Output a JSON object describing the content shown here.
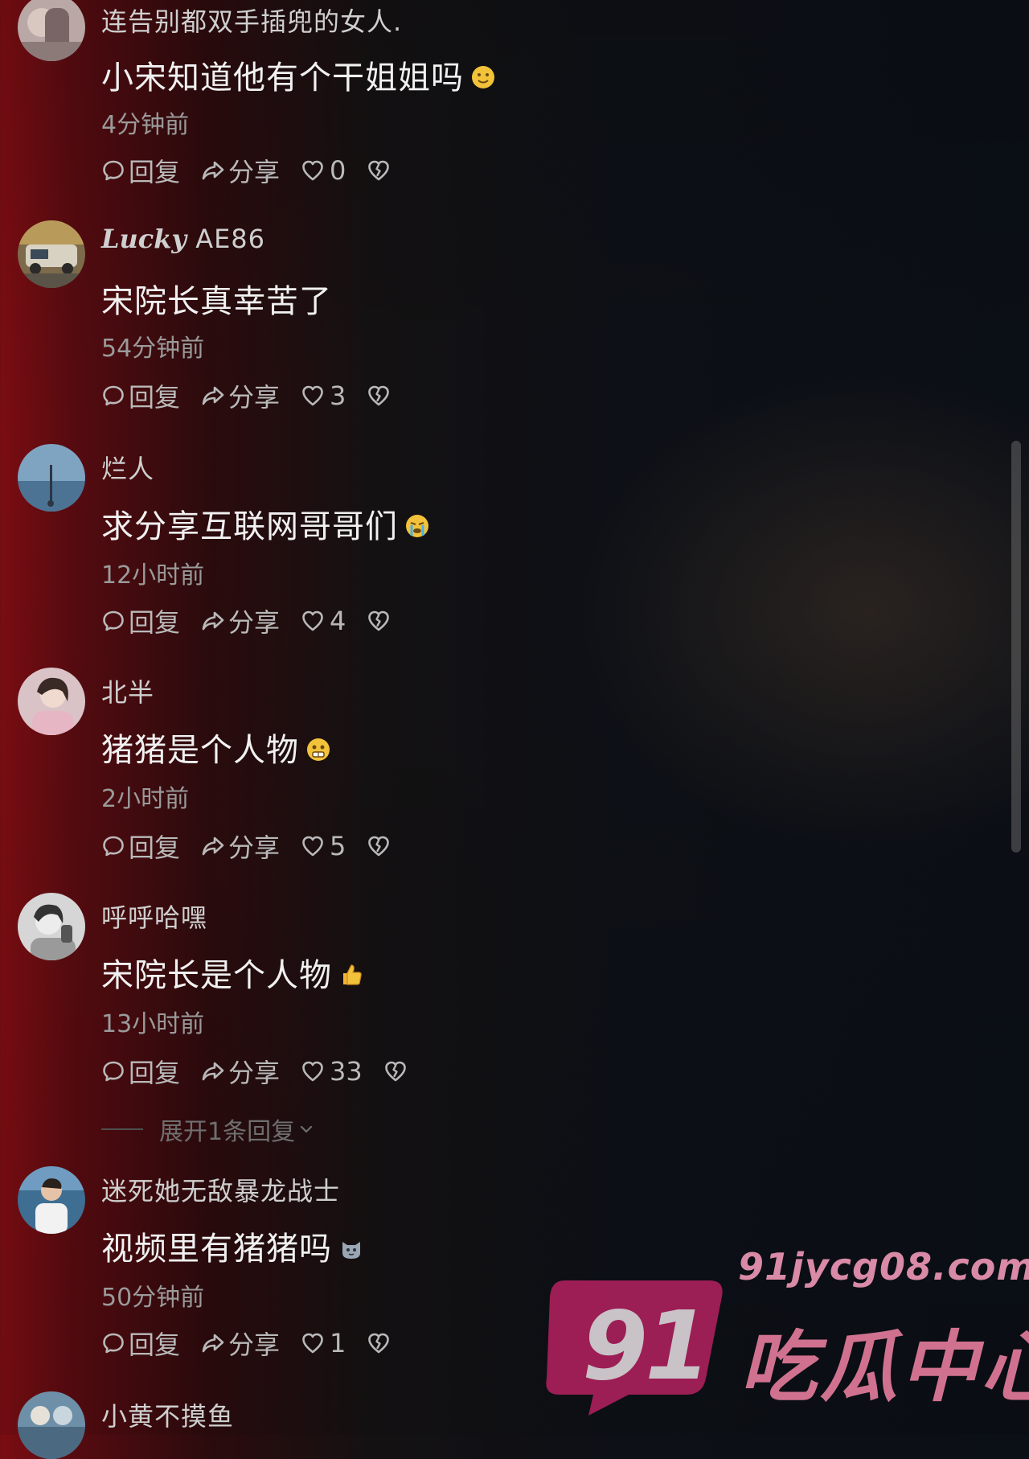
{
  "comments": [
    {
      "username": "连告别都双手插兜的女人.",
      "text": "小宋知道他有个干姐姐吗",
      "emoji": "smile-emoji",
      "time": "4分钟前",
      "reply_label": "回复",
      "share_label": "分享",
      "likes": "0"
    },
    {
      "username_script": "Lucky",
      "username": "AE86",
      "text": "宋院长真幸苦了",
      "time": "54分钟前",
      "reply_label": "回复",
      "share_label": "分享",
      "likes": "3"
    },
    {
      "username": "烂人",
      "text": "求分享互联网哥哥们",
      "emoji": "crying-emoji",
      "time": "12小时前",
      "reply_label": "回复",
      "share_label": "分享",
      "likes": "4"
    },
    {
      "username": "北半",
      "text": "猪猪是个人物",
      "emoji": "grimace-emoji",
      "time": "2小时前",
      "reply_label": "回复",
      "share_label": "分享",
      "likes": "5"
    },
    {
      "username": "呼呼哈嘿",
      "text": "宋院长是个人物",
      "emoji": "thumbs-up-emoji",
      "time": "13小时前",
      "reply_label": "回复",
      "share_label": "分享",
      "likes": "33",
      "expand_label": "展开1条回复"
    },
    {
      "username": "迷死她无敌暴龙战士",
      "text": "视频里有猪猪吗",
      "emoji": "cat-emoji",
      "time": "50分钟前",
      "reply_label": "回复",
      "share_label": "分享",
      "likes": "1"
    },
    {
      "username": "小黄不摸鱼"
    }
  ],
  "watermark": {
    "number": "91",
    "domain": "91jycg08.com",
    "title": "吃瓜中心"
  }
}
